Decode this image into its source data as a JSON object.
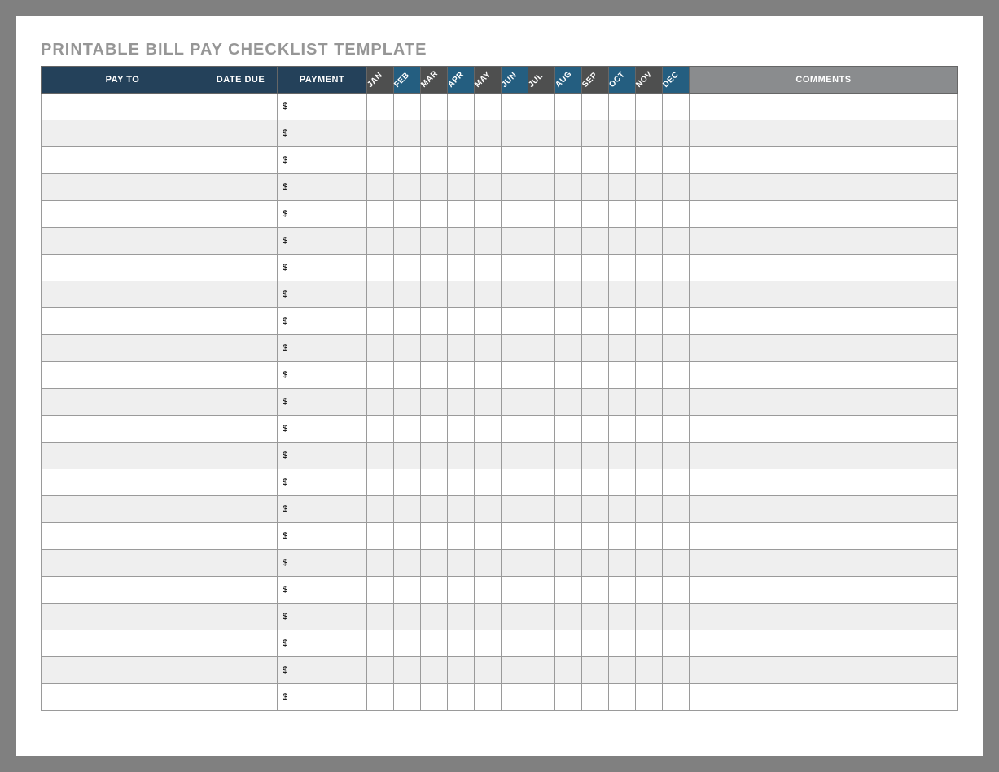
{
  "title": "PRINTABLE BILL PAY CHECKLIST TEMPLATE",
  "headers": {
    "payto": "PAY TO",
    "date": "DATE DUE",
    "payment": "PAYMENT",
    "comments": "COMMENTS"
  },
  "months": [
    "JAN",
    "FEB",
    "MAR",
    "APR",
    "MAY",
    "JUN",
    "JUL",
    "AUG",
    "SEP",
    "OCT",
    "NOV",
    "DEC"
  ],
  "currency_symbol": "$",
  "rows": [
    {
      "payto": "",
      "date": "",
      "payment": "",
      "comments": "",
      "months": [
        "",
        "",
        "",
        "",
        "",
        "",
        "",
        "",
        "",
        "",
        "",
        ""
      ]
    },
    {
      "payto": "",
      "date": "",
      "payment": "",
      "comments": "",
      "months": [
        "",
        "",
        "",
        "",
        "",
        "",
        "",
        "",
        "",
        "",
        "",
        ""
      ]
    },
    {
      "payto": "",
      "date": "",
      "payment": "",
      "comments": "",
      "months": [
        "",
        "",
        "",
        "",
        "",
        "",
        "",
        "",
        "",
        "",
        "",
        ""
      ]
    },
    {
      "payto": "",
      "date": "",
      "payment": "",
      "comments": "",
      "months": [
        "",
        "",
        "",
        "",
        "",
        "",
        "",
        "",
        "",
        "",
        "",
        ""
      ]
    },
    {
      "payto": "",
      "date": "",
      "payment": "",
      "comments": "",
      "months": [
        "",
        "",
        "",
        "",
        "",
        "",
        "",
        "",
        "",
        "",
        "",
        ""
      ]
    },
    {
      "payto": "",
      "date": "",
      "payment": "",
      "comments": "",
      "months": [
        "",
        "",
        "",
        "",
        "",
        "",
        "",
        "",
        "",
        "",
        "",
        ""
      ]
    },
    {
      "payto": "",
      "date": "",
      "payment": "",
      "comments": "",
      "months": [
        "",
        "",
        "",
        "",
        "",
        "",
        "",
        "",
        "",
        "",
        "",
        ""
      ]
    },
    {
      "payto": "",
      "date": "",
      "payment": "",
      "comments": "",
      "months": [
        "",
        "",
        "",
        "",
        "",
        "",
        "",
        "",
        "",
        "",
        "",
        ""
      ]
    },
    {
      "payto": "",
      "date": "",
      "payment": "",
      "comments": "",
      "months": [
        "",
        "",
        "",
        "",
        "",
        "",
        "",
        "",
        "",
        "",
        "",
        ""
      ]
    },
    {
      "payto": "",
      "date": "",
      "payment": "",
      "comments": "",
      "months": [
        "",
        "",
        "",
        "",
        "",
        "",
        "",
        "",
        "",
        "",
        "",
        ""
      ]
    },
    {
      "payto": "",
      "date": "",
      "payment": "",
      "comments": "",
      "months": [
        "",
        "",
        "",
        "",
        "",
        "",
        "",
        "",
        "",
        "",
        "",
        ""
      ]
    },
    {
      "payto": "",
      "date": "",
      "payment": "",
      "comments": "",
      "months": [
        "",
        "",
        "",
        "",
        "",
        "",
        "",
        "",
        "",
        "",
        "",
        ""
      ]
    },
    {
      "payto": "",
      "date": "",
      "payment": "",
      "comments": "",
      "months": [
        "",
        "",
        "",
        "",
        "",
        "",
        "",
        "",
        "",
        "",
        "",
        ""
      ]
    },
    {
      "payto": "",
      "date": "",
      "payment": "",
      "comments": "",
      "months": [
        "",
        "",
        "",
        "",
        "",
        "",
        "",
        "",
        "",
        "",
        "",
        ""
      ]
    },
    {
      "payto": "",
      "date": "",
      "payment": "",
      "comments": "",
      "months": [
        "",
        "",
        "",
        "",
        "",
        "",
        "",
        "",
        "",
        "",
        "",
        ""
      ]
    },
    {
      "payto": "",
      "date": "",
      "payment": "",
      "comments": "",
      "months": [
        "",
        "",
        "",
        "",
        "",
        "",
        "",
        "",
        "",
        "",
        "",
        ""
      ]
    },
    {
      "payto": "",
      "date": "",
      "payment": "",
      "comments": "",
      "months": [
        "",
        "",
        "",
        "",
        "",
        "",
        "",
        "",
        "",
        "",
        "",
        ""
      ]
    },
    {
      "payto": "",
      "date": "",
      "payment": "",
      "comments": "",
      "months": [
        "",
        "",
        "",
        "",
        "",
        "",
        "",
        "",
        "",
        "",
        "",
        ""
      ]
    },
    {
      "payto": "",
      "date": "",
      "payment": "",
      "comments": "",
      "months": [
        "",
        "",
        "",
        "",
        "",
        "",
        "",
        "",
        "",
        "",
        "",
        ""
      ]
    },
    {
      "payto": "",
      "date": "",
      "payment": "",
      "comments": "",
      "months": [
        "",
        "",
        "",
        "",
        "",
        "",
        "",
        "",
        "",
        "",
        "",
        ""
      ]
    },
    {
      "payto": "",
      "date": "",
      "payment": "",
      "comments": "",
      "months": [
        "",
        "",
        "",
        "",
        "",
        "",
        "",
        "",
        "",
        "",
        "",
        ""
      ]
    },
    {
      "payto": "",
      "date": "",
      "payment": "",
      "comments": "",
      "months": [
        "",
        "",
        "",
        "",
        "",
        "",
        "",
        "",
        "",
        "",
        "",
        ""
      ]
    },
    {
      "payto": "",
      "date": "",
      "payment": "",
      "comments": "",
      "months": [
        "",
        "",
        "",
        "",
        "",
        "",
        "",
        "",
        "",
        "",
        "",
        ""
      ]
    }
  ]
}
